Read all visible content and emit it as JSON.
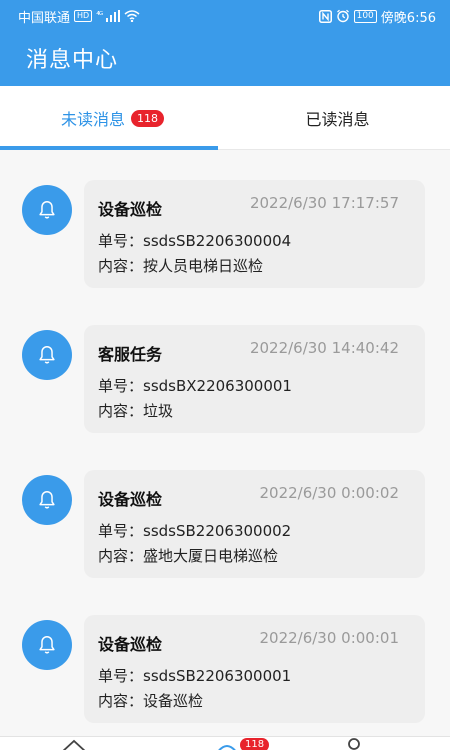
{
  "status_bar": {
    "carrier": "中国联通",
    "hd": "HD",
    "network": "⁴ᴳ",
    "battery": "100",
    "time": "傍晚6:56"
  },
  "app": {
    "title": "消息中心"
  },
  "tabs": {
    "unread_label": "未读消息",
    "unread_count": "118",
    "read_label": "已读消息"
  },
  "messages": [
    {
      "title": "设备巡检",
      "time": "2022/6/30 17:17:57",
      "number": "单号：ssdsSB2206300004",
      "content": "内容：按人员电梯日巡检"
    },
    {
      "title": "客服任务",
      "time": "2022/6/30 14:40:42",
      "number": "单号：ssdsBX2206300001",
      "content": "内容：垃圾"
    },
    {
      "title": "设备巡检",
      "time": "2022/6/30 0:00:02",
      "number": "单号：ssdsSB2206300002",
      "content": "内容：盛地大厦日电梯巡检"
    },
    {
      "title": "设备巡检",
      "time": "2022/6/30 0:00:01",
      "number": "单号：ssdsSB2206300001",
      "content": "内容：设备巡检"
    }
  ],
  "bottom_nav": {
    "badge": "118"
  },
  "colors": {
    "primary": "#3a9bea",
    "badge": "#e8232c",
    "card": "#eeeeee"
  }
}
